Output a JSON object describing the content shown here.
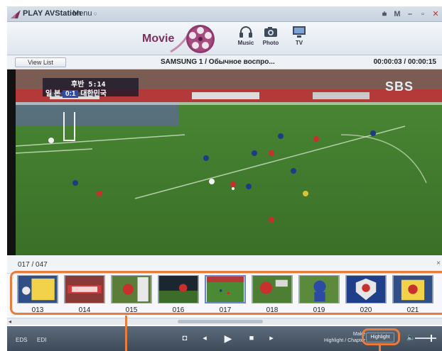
{
  "window": {
    "app_title": "PLAY AVStation",
    "menu_label": "Menu",
    "min_label": "M"
  },
  "modes": {
    "active": "Movie",
    "items": [
      {
        "label": "Music",
        "icon": "headphones-icon"
      },
      {
        "label": "Photo",
        "icon": "camera-icon"
      },
      {
        "label": "TV",
        "icon": "monitor-icon"
      }
    ]
  },
  "infobar": {
    "view_list": "View List",
    "track_title": "SAMSUNG 1  /  Обычное воспро...",
    "time": "00:00:03 / 00:00:15"
  },
  "video": {
    "score_time": "후반 5:14",
    "score_left": "일 본",
    "score": "0:1",
    "score_right": "대한민국",
    "broadcaster": "SBS"
  },
  "strip": {
    "counter": "017 / 047",
    "close": "×",
    "selected": "017",
    "thumbnails": [
      "013",
      "014",
      "015",
      "016",
      "017",
      "018",
      "019",
      "020",
      "021"
    ]
  },
  "controls": {
    "eds": "EDS",
    "edi": "EDI",
    "make_highlight_line1": "Make",
    "make_highlight_line2": "Highlight / Chapter",
    "highlight_button": "Highlight"
  },
  "colors": {
    "callout": "#e87c3c",
    "pitch": "#3f7a2c",
    "mode_title": "#7a2f5e"
  }
}
